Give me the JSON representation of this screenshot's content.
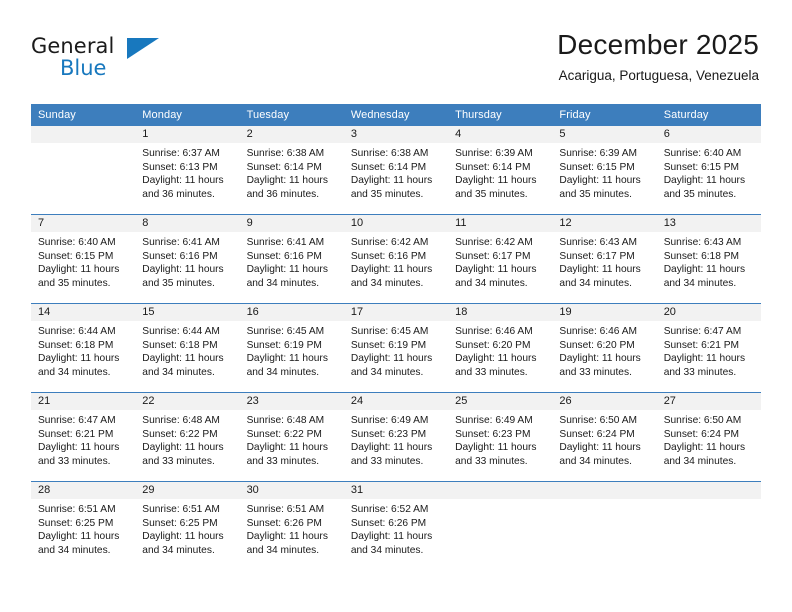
{
  "brand": {
    "name_top": "General",
    "name_bottom": "Blue",
    "triangle_icon": "triangle-icon",
    "accent_color": "#1878be"
  },
  "header": {
    "title": "December 2025",
    "subtitle": "Acarigua, Portuguesa, Venezuela"
  },
  "theme": {
    "header_bar": "#3d7ebd",
    "row_divider": "#3d7ebd",
    "daynum_band": "#f2f2f2",
    "text": "#1a1a1a"
  },
  "calendar": {
    "weekday_headers": [
      "Sunday",
      "Monday",
      "Tuesday",
      "Wednesday",
      "Thursday",
      "Friday",
      "Saturday"
    ],
    "weeks": [
      [
        {
          "day": "",
          "empty": true,
          "sunrise": "",
          "sunset": "",
          "daylight_line1": "",
          "daylight_line2": ""
        },
        {
          "day": "1",
          "sunrise": "Sunrise: 6:37 AM",
          "sunset": "Sunset: 6:13 PM",
          "daylight_line1": "Daylight: 11 hours",
          "daylight_line2": "and 36 minutes."
        },
        {
          "day": "2",
          "sunrise": "Sunrise: 6:38 AM",
          "sunset": "Sunset: 6:14 PM",
          "daylight_line1": "Daylight: 11 hours",
          "daylight_line2": "and 36 minutes."
        },
        {
          "day": "3",
          "sunrise": "Sunrise: 6:38 AM",
          "sunset": "Sunset: 6:14 PM",
          "daylight_line1": "Daylight: 11 hours",
          "daylight_line2": "and 35 minutes."
        },
        {
          "day": "4",
          "sunrise": "Sunrise: 6:39 AM",
          "sunset": "Sunset: 6:14 PM",
          "daylight_line1": "Daylight: 11 hours",
          "daylight_line2": "and 35 minutes."
        },
        {
          "day": "5",
          "sunrise": "Sunrise: 6:39 AM",
          "sunset": "Sunset: 6:15 PM",
          "daylight_line1": "Daylight: 11 hours",
          "daylight_line2": "and 35 minutes."
        },
        {
          "day": "6",
          "sunrise": "Sunrise: 6:40 AM",
          "sunset": "Sunset: 6:15 PM",
          "daylight_line1": "Daylight: 11 hours",
          "daylight_line2": "and 35 minutes."
        }
      ],
      [
        {
          "day": "7",
          "sunrise": "Sunrise: 6:40 AM",
          "sunset": "Sunset: 6:15 PM",
          "daylight_line1": "Daylight: 11 hours",
          "daylight_line2": "and 35 minutes."
        },
        {
          "day": "8",
          "sunrise": "Sunrise: 6:41 AM",
          "sunset": "Sunset: 6:16 PM",
          "daylight_line1": "Daylight: 11 hours",
          "daylight_line2": "and 35 minutes."
        },
        {
          "day": "9",
          "sunrise": "Sunrise: 6:41 AM",
          "sunset": "Sunset: 6:16 PM",
          "daylight_line1": "Daylight: 11 hours",
          "daylight_line2": "and 34 minutes."
        },
        {
          "day": "10",
          "sunrise": "Sunrise: 6:42 AM",
          "sunset": "Sunset: 6:16 PM",
          "daylight_line1": "Daylight: 11 hours",
          "daylight_line2": "and 34 minutes."
        },
        {
          "day": "11",
          "sunrise": "Sunrise: 6:42 AM",
          "sunset": "Sunset: 6:17 PM",
          "daylight_line1": "Daylight: 11 hours",
          "daylight_line2": "and 34 minutes."
        },
        {
          "day": "12",
          "sunrise": "Sunrise: 6:43 AM",
          "sunset": "Sunset: 6:17 PM",
          "daylight_line1": "Daylight: 11 hours",
          "daylight_line2": "and 34 minutes."
        },
        {
          "day": "13",
          "sunrise": "Sunrise: 6:43 AM",
          "sunset": "Sunset: 6:18 PM",
          "daylight_line1": "Daylight: 11 hours",
          "daylight_line2": "and 34 minutes."
        }
      ],
      [
        {
          "day": "14",
          "sunrise": "Sunrise: 6:44 AM",
          "sunset": "Sunset: 6:18 PM",
          "daylight_line1": "Daylight: 11 hours",
          "daylight_line2": "and 34 minutes."
        },
        {
          "day": "15",
          "sunrise": "Sunrise: 6:44 AM",
          "sunset": "Sunset: 6:18 PM",
          "daylight_line1": "Daylight: 11 hours",
          "daylight_line2": "and 34 minutes."
        },
        {
          "day": "16",
          "sunrise": "Sunrise: 6:45 AM",
          "sunset": "Sunset: 6:19 PM",
          "daylight_line1": "Daylight: 11 hours",
          "daylight_line2": "and 34 minutes."
        },
        {
          "day": "17",
          "sunrise": "Sunrise: 6:45 AM",
          "sunset": "Sunset: 6:19 PM",
          "daylight_line1": "Daylight: 11 hours",
          "daylight_line2": "and 34 minutes."
        },
        {
          "day": "18",
          "sunrise": "Sunrise: 6:46 AM",
          "sunset": "Sunset: 6:20 PM",
          "daylight_line1": "Daylight: 11 hours",
          "daylight_line2": "and 33 minutes."
        },
        {
          "day": "19",
          "sunrise": "Sunrise: 6:46 AM",
          "sunset": "Sunset: 6:20 PM",
          "daylight_line1": "Daylight: 11 hours",
          "daylight_line2": "and 33 minutes."
        },
        {
          "day": "20",
          "sunrise": "Sunrise: 6:47 AM",
          "sunset": "Sunset: 6:21 PM",
          "daylight_line1": "Daylight: 11 hours",
          "daylight_line2": "and 33 minutes."
        }
      ],
      [
        {
          "day": "21",
          "sunrise": "Sunrise: 6:47 AM",
          "sunset": "Sunset: 6:21 PM",
          "daylight_line1": "Daylight: 11 hours",
          "daylight_line2": "and 33 minutes."
        },
        {
          "day": "22",
          "sunrise": "Sunrise: 6:48 AM",
          "sunset": "Sunset: 6:22 PM",
          "daylight_line1": "Daylight: 11 hours",
          "daylight_line2": "and 33 minutes."
        },
        {
          "day": "23",
          "sunrise": "Sunrise: 6:48 AM",
          "sunset": "Sunset: 6:22 PM",
          "daylight_line1": "Daylight: 11 hours",
          "daylight_line2": "and 33 minutes."
        },
        {
          "day": "24",
          "sunrise": "Sunrise: 6:49 AM",
          "sunset": "Sunset: 6:23 PM",
          "daylight_line1": "Daylight: 11 hours",
          "daylight_line2": "and 33 minutes."
        },
        {
          "day": "25",
          "sunrise": "Sunrise: 6:49 AM",
          "sunset": "Sunset: 6:23 PM",
          "daylight_line1": "Daylight: 11 hours",
          "daylight_line2": "and 33 minutes."
        },
        {
          "day": "26",
          "sunrise": "Sunrise: 6:50 AM",
          "sunset": "Sunset: 6:24 PM",
          "daylight_line1": "Daylight: 11 hours",
          "daylight_line2": "and 34 minutes."
        },
        {
          "day": "27",
          "sunrise": "Sunrise: 6:50 AM",
          "sunset": "Sunset: 6:24 PM",
          "daylight_line1": "Daylight: 11 hours",
          "daylight_line2": "and 34 minutes."
        }
      ],
      [
        {
          "day": "28",
          "sunrise": "Sunrise: 6:51 AM",
          "sunset": "Sunset: 6:25 PM",
          "daylight_line1": "Daylight: 11 hours",
          "daylight_line2": "and 34 minutes."
        },
        {
          "day": "29",
          "sunrise": "Sunrise: 6:51 AM",
          "sunset": "Sunset: 6:25 PM",
          "daylight_line1": "Daylight: 11 hours",
          "daylight_line2": "and 34 minutes."
        },
        {
          "day": "30",
          "sunrise": "Sunrise: 6:51 AM",
          "sunset": "Sunset: 6:26 PM",
          "daylight_line1": "Daylight: 11 hours",
          "daylight_line2": "and 34 minutes."
        },
        {
          "day": "31",
          "sunrise": "Sunrise: 6:52 AM",
          "sunset": "Sunset: 6:26 PM",
          "daylight_line1": "Daylight: 11 hours",
          "daylight_line2": "and 34 minutes."
        },
        {
          "day": "",
          "empty": true,
          "sunrise": "",
          "sunset": "",
          "daylight_line1": "",
          "daylight_line2": ""
        },
        {
          "day": "",
          "empty": true,
          "sunrise": "",
          "sunset": "",
          "daylight_line1": "",
          "daylight_line2": ""
        },
        {
          "day": "",
          "empty": true,
          "sunrise": "",
          "sunset": "",
          "daylight_line1": "",
          "daylight_line2": ""
        }
      ]
    ]
  }
}
